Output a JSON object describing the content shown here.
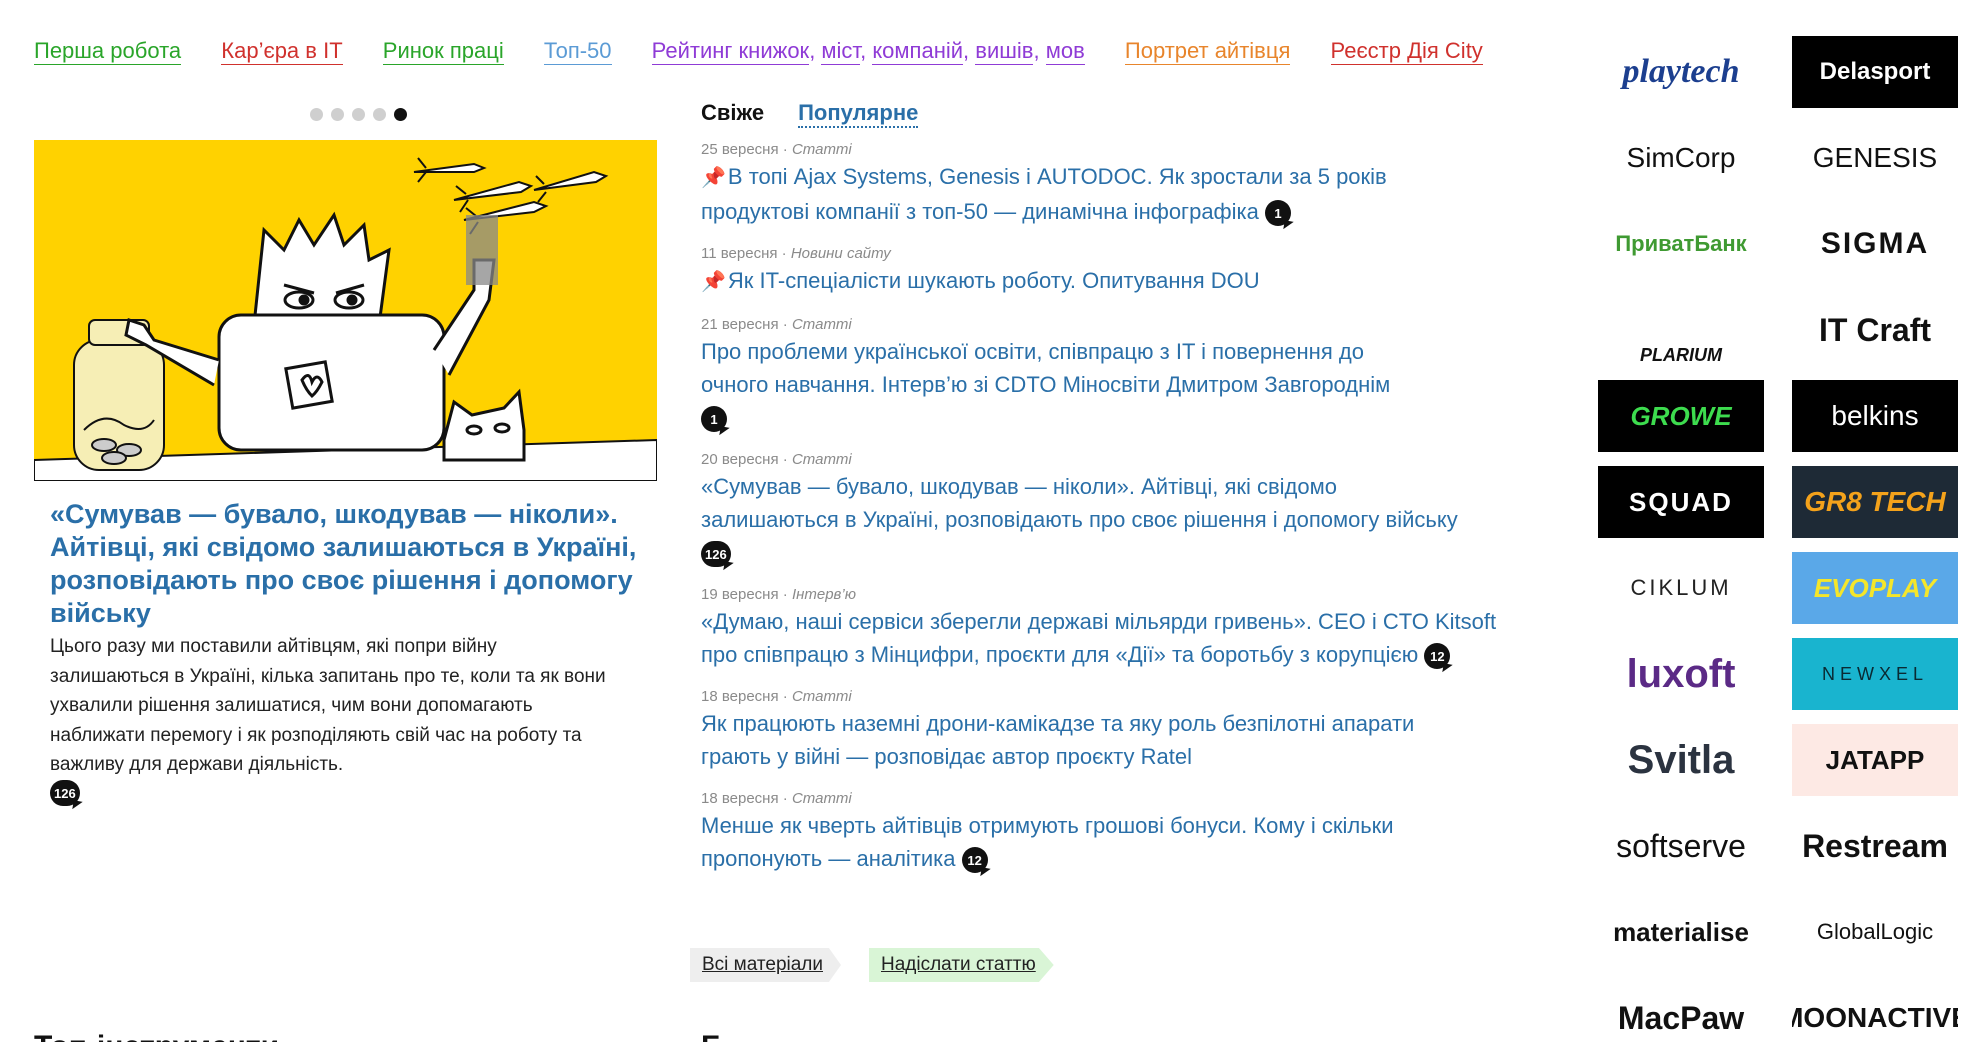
{
  "nav": {
    "items": [
      {
        "label": "Перша робота",
        "color": "#2aa52a"
      },
      {
        "label": "Кар’єра в IT",
        "color": "#d0312d"
      },
      {
        "label": "Ринок праці",
        "color": "#2aa52a"
      },
      {
        "label": "Топ-50",
        "color": "#5b9bd5"
      }
    ],
    "ratings": {
      "prefix": "Рейтинг книжок",
      "rest": [
        "міст",
        "компаній",
        "вишів",
        "мов"
      ],
      "color": "#8f3bd6"
    },
    "tail": [
      {
        "label": "Портрет айтівця",
        "color": "#e8852c"
      },
      {
        "label": "Реєстр Дія City",
        "color": "#d0312d"
      }
    ]
  },
  "slider": {
    "dots": 5,
    "active_index": 4
  },
  "lead": {
    "title": "«Сумував — бувало, шкодував — ніколи». Айтівці, які свідомо залишаються в Україні, розповідають про своє рішення і допомогу війську",
    "text": "Цього разу ми поставили айтівцям, які попри війну залишаються в Україні, кілька запитань про те, коли та як вони ухвалили рішення залишатися, чим вони допомагають наближати перемогу і як розподіляють свій час на роботу та важливу для держави діяльність.",
    "comments": "126"
  },
  "tabs": {
    "fresh": "Свіже",
    "popular": "Популярне"
  },
  "feed": [
    {
      "date": "25 вересня",
      "category": "Статті",
      "pinned": true,
      "title": "В топі Ajax Systems, Genesis і AUTODOC. Як зростали за 5 років продуктові компанії з топ-50 — динамічна інфографіка",
      "comments": "1"
    },
    {
      "date": "11 вересня",
      "category": "Новини сайту",
      "pinned": true,
      "title": "Як IT-спеціалісти шукають роботу. Опитування DOU",
      "comments": ""
    },
    {
      "date": "21 вересня",
      "category": "Статті",
      "pinned": false,
      "title": "Про проблеми української освіти, співпрацю з IT і повернення до очного навчання. Інтерв’ю зі CDTO Міносвіти Дмитром Завгороднім",
      "comments": "1"
    },
    {
      "date": "20 вересня",
      "category": "Статті",
      "pinned": false,
      "title": "«Сумував — бувало, шкодував — ніколи». Айтівці, які свідомо залишаються в Україні, розповідають про своє рішення і допомогу війську",
      "comments": "126"
    },
    {
      "date": "19 вересня",
      "category": "Інтерв’ю",
      "pinned": false,
      "title": "«Думаю, наші сервіси зберегли державі мільярди гривень». CEO і CTO Kitsoft про співпрацю з Мінцифри, проєкти для «Дії» та боротьбу з корупцією",
      "comments": "12"
    },
    {
      "date": "18 вересня",
      "category": "Статті",
      "pinned": false,
      "title": "Як працюють наземні дрони-камікадзе та яку роль безпілотні апарати грають у війні — розповідає автор проєкту Ratel",
      "comments": ""
    },
    {
      "date": "18 вересня",
      "category": "Статті",
      "pinned": false,
      "title": "Менше як чверть айтівців отримують грошові бонуси. Кому і скільки пропонують — аналітика",
      "comments": "12"
    }
  ],
  "buttons": {
    "all": "Всі матеріали",
    "submit": "Надіслати статтю"
  },
  "peek": {
    "left": "Топ-інструменти",
    "right": "Б"
  },
  "sponsors": [
    {
      "name": "playtech",
      "text": "playtech",
      "bg": "#ffffff",
      "fg": "#1c3f8f"
    },
    {
      "name": "delasport",
      "text": "Delasport",
      "bg": "#000000",
      "fg": "#ffffff"
    },
    {
      "name": "simcorp",
      "text": "SimCorp",
      "bg": "#ffffff",
      "fg": "#111111"
    },
    {
      "name": "genesis",
      "text": "GENESIS",
      "bg": "#ffffff",
      "fg": "#111111"
    },
    {
      "name": "privatbank",
      "text": "ПриватБанк",
      "bg": "#ffffff",
      "fg": "#3f9a32"
    },
    {
      "name": "sigma",
      "text": "SIGMA",
      "bg": "#ffffff",
      "fg": "#111111"
    },
    {
      "name": "plarium",
      "text": "PLARIUM",
      "bg": "#ffffff",
      "fg": "#111111"
    },
    {
      "name": "itcraft",
      "text": "IT Craft",
      "bg": "#ffffff",
      "fg": "#111111"
    },
    {
      "name": "growe",
      "text": "GROWE",
      "bg": "#000000",
      "fg": "#3ddc4e"
    },
    {
      "name": "belkins",
      "text": "belkins",
      "bg": "#000000",
      "fg": "#ffffff"
    },
    {
      "name": "squad",
      "text": "SQUAD",
      "bg": "#000000",
      "fg": "#ffffff"
    },
    {
      "name": "gr8tech",
      "text": "GR8 TECH",
      "bg": "#1e2a36",
      "fg": "#f4a21b"
    },
    {
      "name": "ciklum",
      "text": "CIKLUM",
      "bg": "#ffffff",
      "fg": "#222222"
    },
    {
      "name": "evoplay",
      "text": "EVOPLAY",
      "bg": "#5aa8e8",
      "fg": "#f5e62a"
    },
    {
      "name": "luxoft",
      "text": "luxoft",
      "bg": "#ffffff",
      "fg": "#5b2a86"
    },
    {
      "name": "newxel",
      "text": "NEWXEL",
      "bg": "#19b4cf",
      "fg": "#0a2a33"
    },
    {
      "name": "svitla",
      "text": "Svitla",
      "bg": "#ffffff",
      "fg": "#2b3340"
    },
    {
      "name": "jatapp",
      "text": "JATAPP",
      "bg": "#fde9e4",
      "fg": "#111111"
    },
    {
      "name": "softserve",
      "text": "softserve",
      "bg": "#ffffff",
      "fg": "#111111"
    },
    {
      "name": "restream",
      "text": "Restream",
      "bg": "#ffffff",
      "fg": "#111111"
    },
    {
      "name": "materialise",
      "text": "materialise",
      "bg": "#ffffff",
      "fg": "#111111"
    },
    {
      "name": "globallogic",
      "text": "GlobalLogic",
      "bg": "#ffffff",
      "fg": "#111111"
    },
    {
      "name": "macpaw",
      "text": "MacPaw",
      "bg": "#ffffff",
      "fg": "#111111"
    },
    {
      "name": "moonactive",
      "text": "MOONACTIVE",
      "bg": "#ffffff",
      "fg": "#111111"
    }
  ]
}
